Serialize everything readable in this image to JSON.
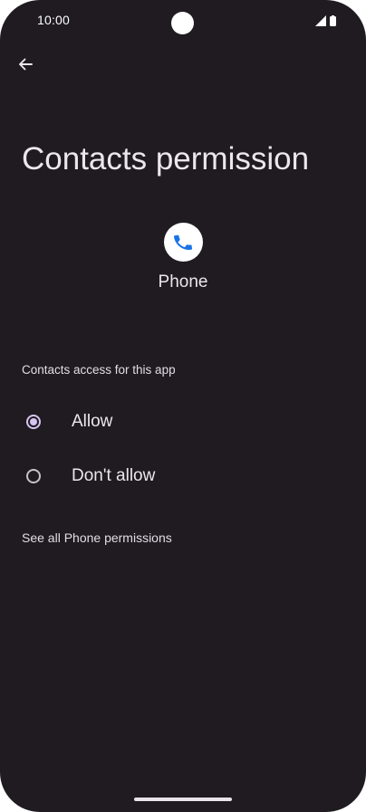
{
  "status_bar": {
    "time": "10:00",
    "icons": [
      "signal-icon",
      "battery-icon"
    ]
  },
  "header": {
    "back_icon": "back-arrow-icon",
    "title": "Contacts permission"
  },
  "app": {
    "icon": "phone-app-icon",
    "name": "Phone"
  },
  "permission": {
    "section_label": "Contacts access for this app",
    "options": [
      {
        "label": "Allow",
        "selected": true
      },
      {
        "label": "Don't allow",
        "selected": false
      }
    ],
    "see_all_link": "See all Phone permissions"
  },
  "colors": {
    "background": "#1f1b21",
    "accent": "#d7c4f0",
    "text": "#ece6ee",
    "phone_icon_blue": "#1a73e8"
  }
}
